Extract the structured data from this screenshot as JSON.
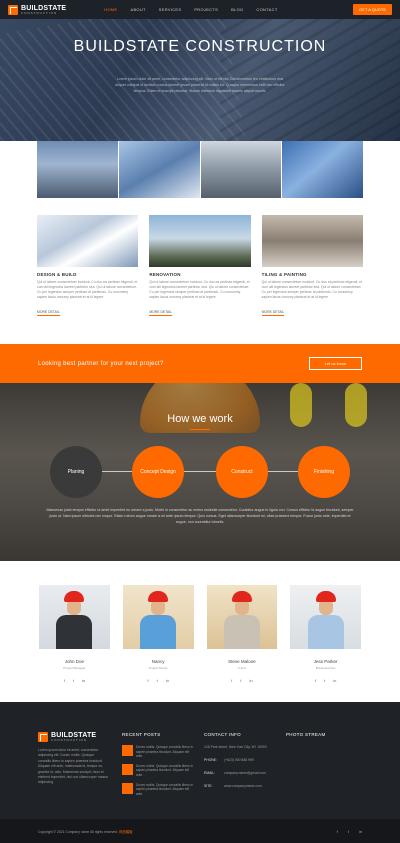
{
  "nav": {
    "logo_name": "BUILDSTATE",
    "logo_sub": "CONSTRUCTION",
    "items": [
      "HOME",
      "ABOUT",
      "SERVICES",
      "PROJECTS",
      "BLOG",
      "CONTACT"
    ],
    "active": "HOME",
    "quote_button": "GET A QUOTE"
  },
  "hero": {
    "title": "BUILDSTATE CONSTRUCTION",
    "text": "Lorem ipsum dolor sit amet, consectetur adipiscing elit. Nam ut elit nisi Condimentum leo vestibulum erat aliquet volutpat id facilisis cursus laoreet ipsum placerat Ut mattis eu. Quisque elementum velit nec efficitur tempus. Etiam et suscipit placerat. Mauris interdum dignissim mauris aliquet iaculis."
  },
  "services": [
    {
      "title": "DESIGN & BUILD",
      "text": "Qui ut labore consectetuer incidunt. Cu duo ea pertinax eligendi, et cum alii legendos laoreet parttntur sea. Qui ut labore consectetuer. Cu per legendos semper pertinax at partiendo. Cu nonummy sapien lacus nonumy placerat et at id legere",
      "more": "MORE DETAIL"
    },
    {
      "title": "RENOVATION",
      "text": "Qui ut labore consectetuer incidunt. Cu duo ea pertinax eligendi, et cum alii legendos laoreet parttntur sea. Qui ut labore consectetuer. Cu per legendos semper pertinax at partiendo. Cu nonummy sapien lacus nonumy placerat et at id legere",
      "more": "MORE DETAIL"
    },
    {
      "title": "TILING & PAINTING",
      "text": "Qui ut labore consectetuer incidunt. Cu duo ea pertinax eligendi, et cum alii legendos laoreet parttntur sea. Qui ut labore consectetuer. Cu per legendos semper pertinax at partiendo. Cu nonummy sapien lacus nonumy placerat et at id legere",
      "more": "MORE DETAIL"
    }
  ],
  "cta": {
    "text": "Looking best partner for your next project?",
    "button": "Let us know"
  },
  "how": {
    "title": "How we work",
    "steps": [
      "Planing",
      "Concept Design",
      "Construct",
      "Finishing"
    ],
    "text": "Maecenas justo tempor efficitur ut amet imperdiet eu ornare a justo. Morbi in consectetur ac metus molestie consectetur. Curabitur augue in ligula orci. Cursus efficitur id augue tincidunt, semper justo ut. Nam ipsum ultricies nec neque. Etiam rutrum augue ornare a mi ante ipsum tempor. Quis cursus. Eget ullamcorper tincidunt mi, vitae praesent tempor. Fusce justo ante, imperdiet et augue, non cuurabitur lobortis."
  },
  "team": [
    {
      "name": "John Doe",
      "role": "Project Manager"
    },
    {
      "name": "Nancy",
      "role": "Project Owner"
    },
    {
      "name": "Steve Malone",
      "role": "C.E.O"
    },
    {
      "name": "Jess Parker",
      "role": "Bussiness Dev"
    }
  ],
  "footer": {
    "about": "Lorem ipsum dolor sit amet, consectetur adipiscing elit. Donec mollis. Quisque convallis libero in sapien pharetra tincidunt. Aliquam elit ante, malesuada id, tempor eu, gravida id, odio. Maecenas suscipit, risus et eleifend imperdiet, nisi orci ullamcorper massa adipiscing",
    "posts_head": "RECENT POSTS",
    "posts": [
      "Donec mollis. Quisque convallis libero in sapien pharetra tincidunt. Aliquam elit ante.",
      "Donec mollis. Quisque convallis libero in sapien pharetra tincidunt. Aliquam elit ante.",
      "Donec mollis. Quisque convallis libero in sapien pharetra tincidunt. Aliquam elit ante."
    ],
    "contact_head": "CONTACT INFO",
    "address": "126 Park street, New York City, NY 10903",
    "phone_label": "PHONE:",
    "phone": "(+623) 000 888 999",
    "email_label": "EMAIL:",
    "email": "company.name@gmail.com",
    "site_label": "SITE:",
    "site": "www.companyname.com",
    "stream_head": "PHOTO STREAM",
    "copyright": "Copyright © 2021 Company name All rights reserved.",
    "copyright_link": "网页模板"
  },
  "colors": {
    "accent": "#ff6a00",
    "dark": "#1f2226"
  }
}
